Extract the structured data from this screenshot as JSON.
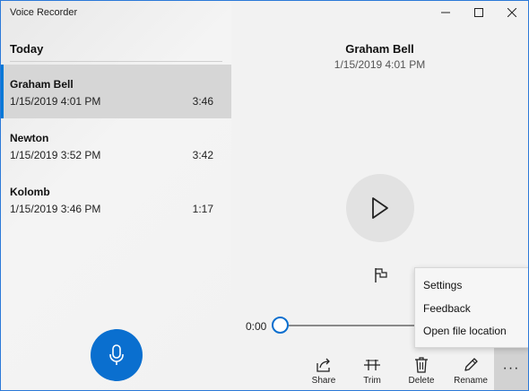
{
  "app": {
    "title": "Voice Recorder"
  },
  "recordings": {
    "section_label": "Today",
    "items": [
      {
        "name": "Graham Bell",
        "date": "1/15/2019 4:01 PM",
        "duration": "3:46",
        "selected": true
      },
      {
        "name": "Newton",
        "date": "1/15/2019 3:52 PM",
        "duration": "3:42",
        "selected": false
      },
      {
        "name": "Kolomb",
        "date": "1/15/2019 3:46 PM",
        "duration": "1:17",
        "selected": false
      }
    ]
  },
  "player": {
    "name": "Graham Bell",
    "date": "1/15/2019 4:01 PM",
    "position": "0:00",
    "progress_fraction": 0.0
  },
  "toolbar": {
    "share_label": "Share",
    "trim_label": "Trim",
    "delete_label": "Delete",
    "rename_label": "Rename",
    "more_label": "···"
  },
  "menu": {
    "settings_label": "Settings",
    "feedback_label": "Feedback",
    "open_location_label": "Open file location"
  },
  "icons": {
    "mic": "microphone-icon",
    "play": "play-icon",
    "flag": "flag-icon",
    "share": "share-icon",
    "trim": "trim-icon",
    "delete": "trash-icon",
    "rename": "pencil-icon",
    "minimize": "minimize-icon",
    "maximize": "maximize-icon",
    "close": "close-icon"
  },
  "colors": {
    "accent": "#0a6fcf",
    "selected_row": "#d6d6d6"
  }
}
